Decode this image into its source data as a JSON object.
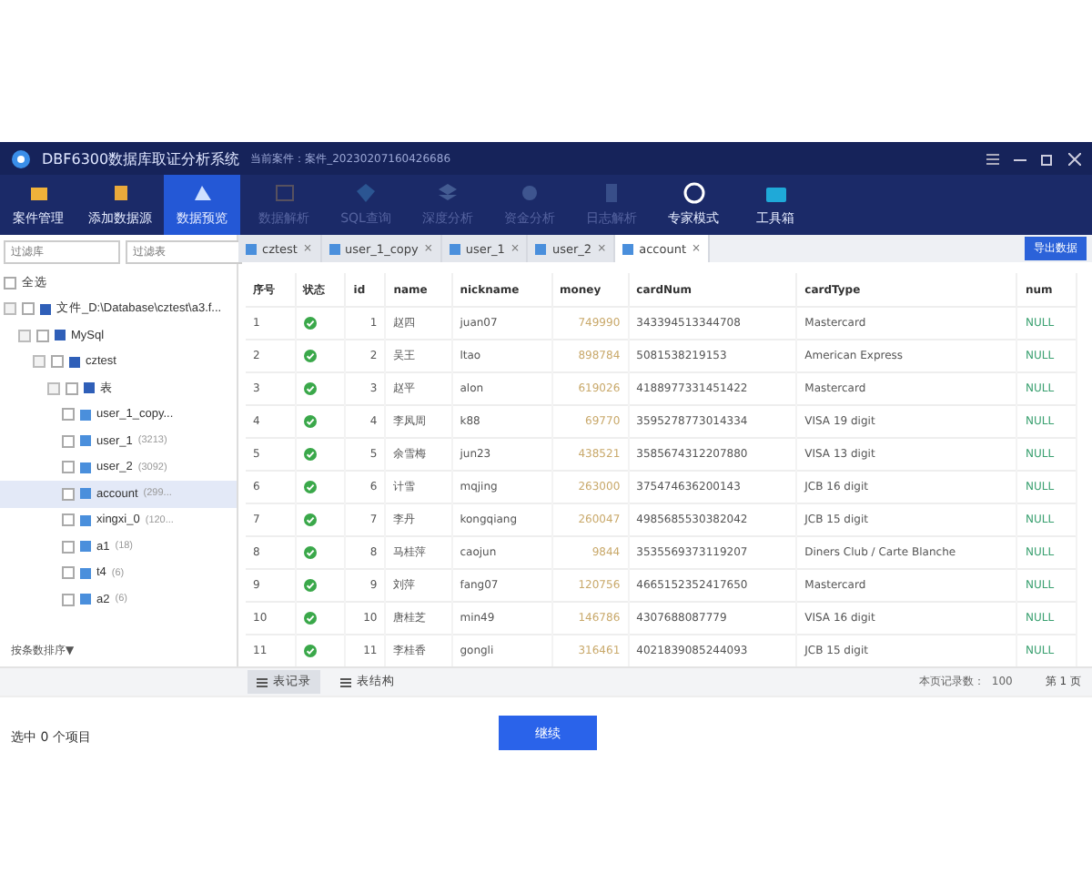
{
  "window": {
    "title": "DBF6300数据库取证分析系统",
    "case": "当前案件：案件_20230207160426686"
  },
  "toolbar": [
    {
      "label": "案件管理",
      "selected": false,
      "disabled": false
    },
    {
      "label": "添加数据源",
      "selected": false,
      "disabled": false
    },
    {
      "label": "数据预览",
      "selected": true,
      "disabled": false
    },
    {
      "label": "数据解析",
      "selected": false,
      "disabled": true
    },
    {
      "label": "SQL查询",
      "selected": false,
      "disabled": true
    },
    {
      "label": "深度分析",
      "selected": false,
      "disabled": true
    },
    {
      "label": "资金分析",
      "selected": false,
      "disabled": true
    },
    {
      "label": "日志解析",
      "selected": false,
      "disabled": true
    },
    {
      "label": "专家模式",
      "selected": false,
      "disabled": false
    },
    {
      "label": "工具箱",
      "selected": false,
      "disabled": false
    }
  ],
  "sidebar": {
    "filters": [
      {
        "placeholder": "过滤库"
      },
      {
        "placeholder": "过滤表"
      }
    ],
    "select_all": {
      "label": "全选",
      "checked": false
    },
    "tree": [
      {
        "label": "文件_D:\\Database\\cztest\\a3.f...",
        "checked": false,
        "expanded": true,
        "children": [
          {
            "label": "MySql",
            "checked": false,
            "expanded": true,
            "children": [
              {
                "label": "cztest",
                "checked": false,
                "expanded": true,
                "children": [
                  {
                    "label": "表",
                    "checked": false,
                    "expanded": true,
                    "children": [
                      {
                        "label": "user_1_copy...",
                        "checked": false,
                        "selected": false
                      },
                      {
                        "label": "user_1",
                        "count": "(3213)",
                        "checked": false,
                        "selected": false
                      },
                      {
                        "label": "user_2",
                        "count": "(3092)",
                        "checked": false,
                        "selected": false
                      },
                      {
                        "label": "account",
                        "count": "(299...",
                        "checked": false,
                        "selected": true
                      },
                      {
                        "label": "xingxi_0",
                        "count": "(120...",
                        "checked": false,
                        "selected": false
                      },
                      {
                        "label": "a1",
                        "count": "(18)",
                        "checked": false,
                        "selected": false
                      },
                      {
                        "label": "t4",
                        "count": "(6)",
                        "checked": false,
                        "selected": false
                      },
                      {
                        "label": "a2",
                        "count": "(6)",
                        "checked": false,
                        "selected": false
                      }
                    ]
                  }
                ]
              }
            ]
          }
        ]
      }
    ],
    "sort": "按条数排序▼"
  },
  "tabs": [
    {
      "label": "cztest",
      "selected": false
    },
    {
      "label": "user_1_copy",
      "selected": false
    },
    {
      "label": "user_1",
      "selected": false
    },
    {
      "label": "user_2",
      "selected": false
    },
    {
      "label": "account",
      "selected": true
    }
  ],
  "close_mark": "×",
  "export_button": "导出数据",
  "table": {
    "columns": [
      "序号",
      "状态",
      "id",
      "name",
      "nickname",
      "money",
      "cardNum",
      "cardType",
      "num"
    ],
    "rows": [
      {
        "cells": [
          "1",
          "",
          "1",
          "赵四",
          "juan07",
          "749990",
          "343394513344708",
          "Mastercard",
          "NULL"
        ],
        "ok": true
      },
      {
        "cells": [
          "2",
          "",
          "2",
          "吴王",
          "ltao",
          "898784",
          "5081538219153",
          "American Express",
          "NULL"
        ],
        "ok": true
      },
      {
        "cells": [
          "3",
          "",
          "3",
          "赵平",
          "alon",
          "619026",
          "4188977331451422",
          "Mastercard",
          "NULL"
        ],
        "ok": true
      },
      {
        "cells": [
          "4",
          "",
          "4",
          "李凤周",
          "k88",
          "69770",
          "3595278773014334",
          "VISA 19 digit",
          "NULL"
        ],
        "ok": true
      },
      {
        "cells": [
          "5",
          "",
          "5",
          "余雪梅",
          "jun23",
          "438521",
          "3585674312207880",
          "VISA 13 digit",
          "NULL"
        ],
        "ok": true
      },
      {
        "cells": [
          "6",
          "",
          "6",
          "计雪",
          "mqjing",
          "263000",
          "375474636200143",
          "JCB 16 digit",
          "NULL"
        ],
        "ok": true
      },
      {
        "cells": [
          "7",
          "",
          "7",
          "李丹",
          "kongqiang",
          "260047",
          "4985685530382042",
          "JCB 15 digit",
          "NULL"
        ],
        "ok": true
      },
      {
        "cells": [
          "8",
          "",
          "8",
          "马桂萍",
          "caojun",
          "9844",
          "3535569373119207",
          "Diners Club / Carte Blanche",
          "NULL"
        ],
        "ok": true
      },
      {
        "cells": [
          "9",
          "",
          "9",
          "刘萍",
          "fang07",
          "120756",
          "4665152352417650",
          "Mastercard",
          "NULL"
        ],
        "ok": true
      },
      {
        "cells": [
          "10",
          "",
          "10",
          "唐桂芝",
          "min49",
          "146786",
          "4307688087779",
          "VISA 16 digit",
          "NULL"
        ],
        "ok": true
      },
      {
        "cells": [
          "11",
          "",
          "11",
          "李桂香",
          "gongli",
          "316461",
          "4021839085244093",
          "JCB 15 digit",
          "NULL"
        ],
        "ok": true
      }
    ]
  },
  "bottom_tabs": [
    {
      "label": "表记录",
      "selected": true
    },
    {
      "label": "表结构",
      "selected": false
    }
  ],
  "records_label": "本页记录数：",
  "records_count": "100",
  "page": "第 1 页",
  "footer": {
    "status": "选中 0 个项目",
    "button": "继续"
  }
}
